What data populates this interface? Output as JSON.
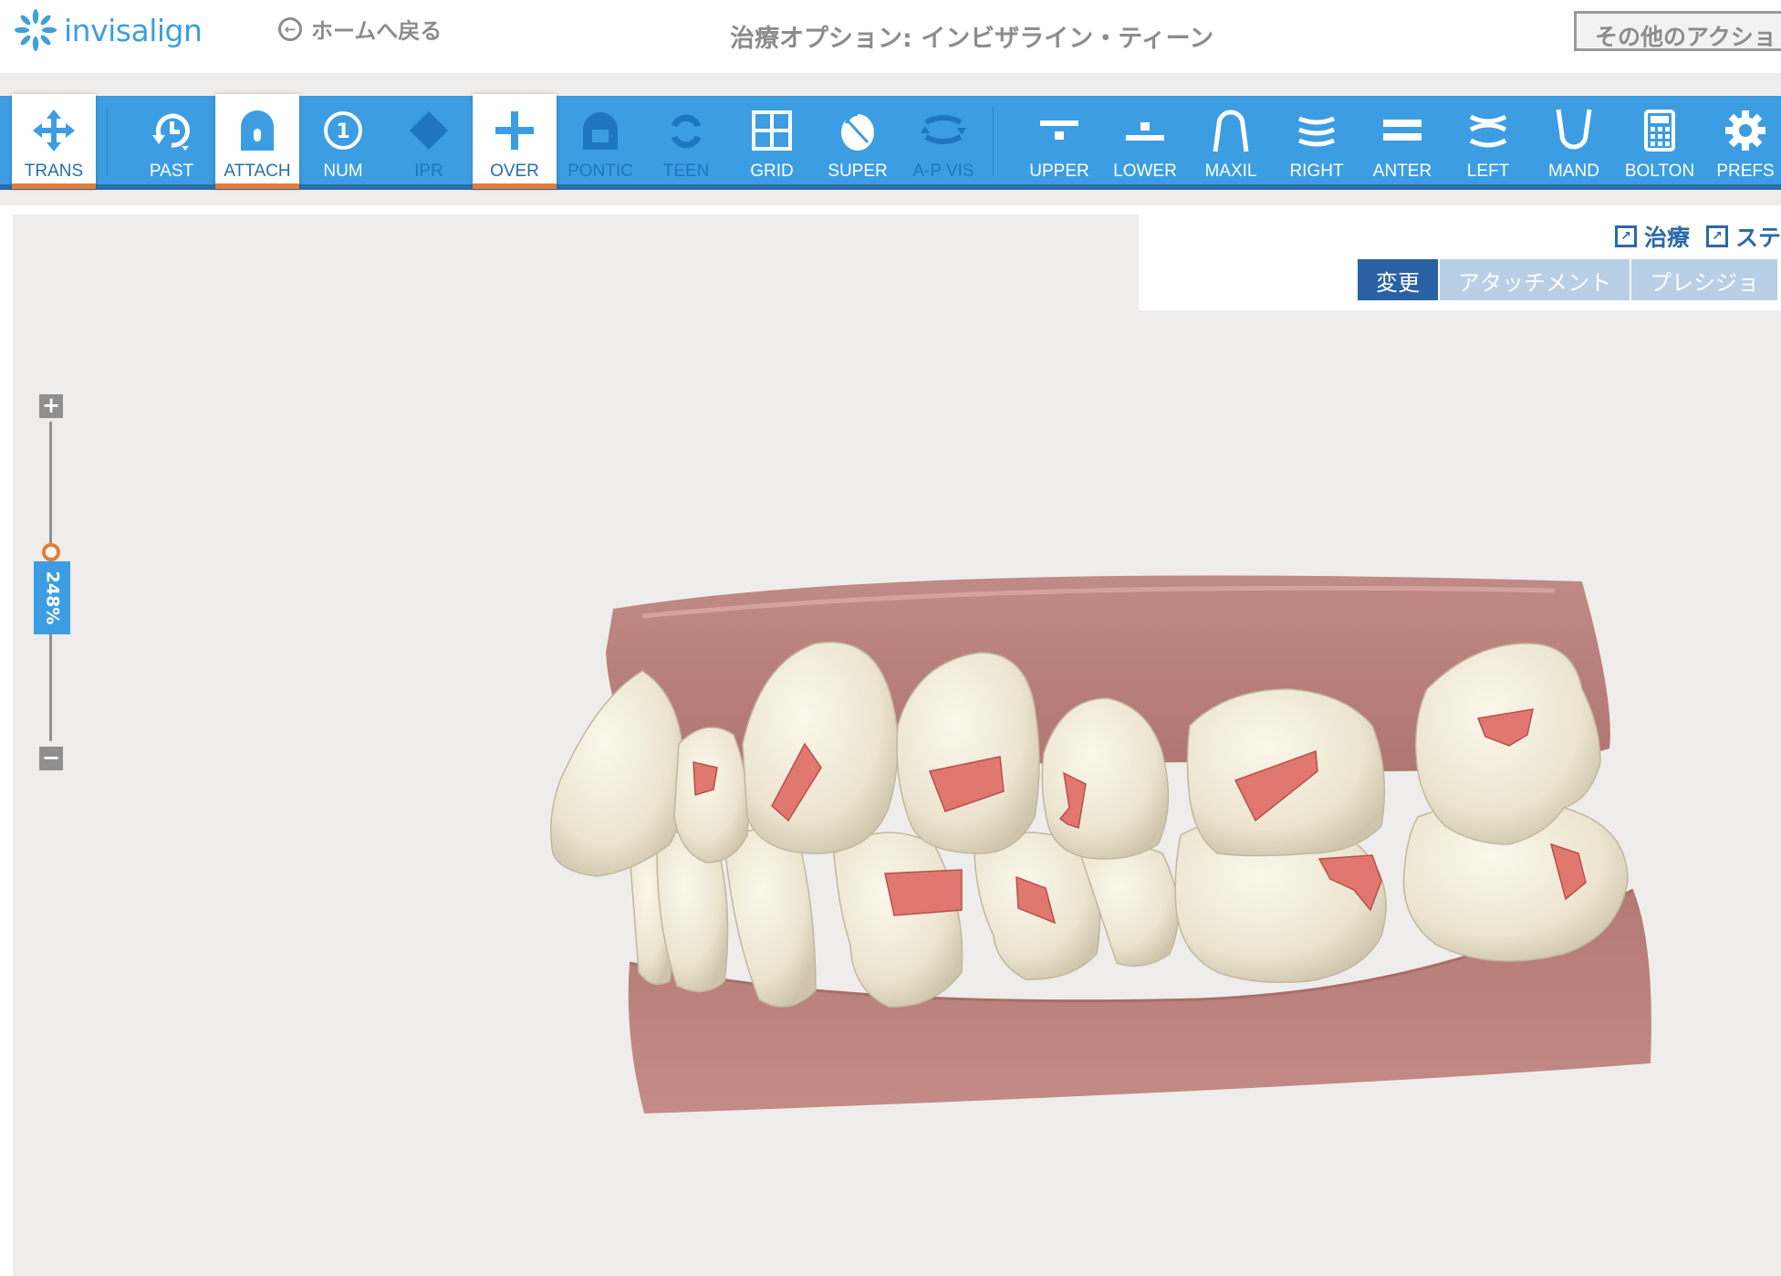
{
  "header": {
    "logo_text": "invisalign",
    "back_label": "ホームへ戻る",
    "title": "治療オプション: インビザライン・ティーン",
    "more_actions_label": "その他のアクショ"
  },
  "toolbar": {
    "tools": [
      {
        "label": "TRANS",
        "icon": "move-arrows-icon",
        "state": "active"
      },
      {
        "label": "PAST",
        "icon": "history-clock-icon",
        "state": "normal"
      },
      {
        "label": "ATTACH",
        "icon": "attachment-icon",
        "state": "active"
      },
      {
        "label": "NUM",
        "icon": "number-one-icon",
        "state": "normal"
      },
      {
        "label": "IPR",
        "icon": "diamond-icon",
        "state": "disabled"
      },
      {
        "label": "OVER",
        "icon": "plus-icon",
        "state": "active"
      },
      {
        "label": "PONTIC",
        "icon": "pontic-icon",
        "state": "disabled"
      },
      {
        "label": "TEEN",
        "icon": "teen-compliance-icon",
        "state": "disabled"
      },
      {
        "label": "GRID",
        "icon": "grid-icon",
        "state": "normal"
      },
      {
        "label": "SUPER",
        "icon": "superimpose-icon",
        "state": "normal"
      },
      {
        "label": "A-P VIS",
        "icon": "ap-visualization-icon",
        "state": "disabled"
      },
      {
        "label": "UPPER",
        "icon": "upper-jaw-icon",
        "state": "normal"
      },
      {
        "label": "LOWER",
        "icon": "lower-jaw-icon",
        "state": "normal"
      },
      {
        "label": "MAXIL",
        "icon": "maxillary-arch-icon",
        "state": "normal"
      },
      {
        "label": "RIGHT",
        "icon": "right-view-icon",
        "state": "normal"
      },
      {
        "label": "ANTER",
        "icon": "anterior-view-icon",
        "state": "normal"
      },
      {
        "label": "LEFT",
        "icon": "left-view-icon",
        "state": "normal"
      },
      {
        "label": "MAND",
        "icon": "mandibular-arch-icon",
        "state": "normal"
      },
      {
        "label": "BOLTON",
        "icon": "calculator-icon",
        "state": "normal"
      },
      {
        "label": "PREFS",
        "icon": "gear-icon",
        "state": "normal"
      }
    ]
  },
  "panel": {
    "links": [
      "治療",
      "ステ"
    ],
    "tabs": [
      {
        "label": "変更",
        "active": true
      },
      {
        "label": "アタッチメント",
        "active": false
      },
      {
        "label": "プレシジョ",
        "active": false
      }
    ]
  },
  "zoom": {
    "plus_label": "+",
    "minus_label": "−",
    "value_label": "248%",
    "level": 0.57
  },
  "colors": {
    "accent": "#3c9de2",
    "toolbar_dark": "#2b6da7",
    "active_underline": "#e57c3a",
    "gum": "#b9817d",
    "tooth": "#ede6d3",
    "attachment": "#e07870",
    "canvas_bg": "#efedeb"
  }
}
